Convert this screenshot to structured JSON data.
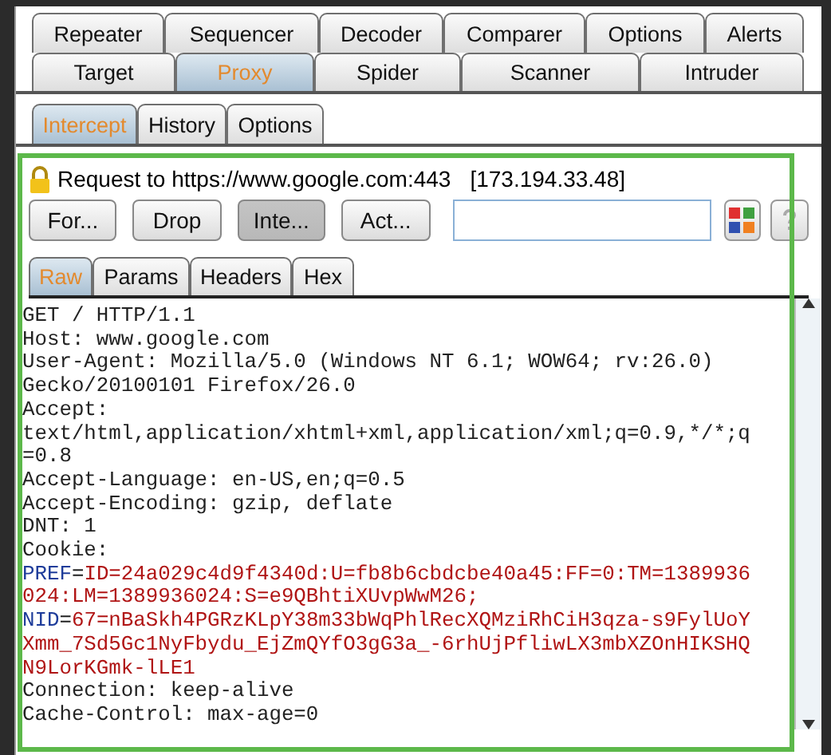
{
  "tab_rows": [
    [
      {
        "label": "Repeater",
        "selected": false
      },
      {
        "label": "Sequencer",
        "selected": false
      },
      {
        "label": "Decoder",
        "selected": false
      },
      {
        "label": "Comparer",
        "selected": false
      },
      {
        "label": "Options",
        "selected": false
      },
      {
        "label": "Alerts",
        "selected": false
      }
    ],
    [
      {
        "label": "Target",
        "selected": false
      },
      {
        "label": "Proxy",
        "selected": true
      },
      {
        "label": "Spider",
        "selected": false
      },
      {
        "label": "Scanner",
        "selected": false
      },
      {
        "label": "Intruder",
        "selected": false
      }
    ]
  ],
  "sub_tabs": [
    {
      "label": "Intercept",
      "selected": true
    },
    {
      "label": "History",
      "selected": false
    },
    {
      "label": "Options",
      "selected": false
    }
  ],
  "request": {
    "label": "Request to https://www.google.com:443",
    "address": "[173.194.33.48]"
  },
  "buttons": [
    {
      "label": "For...",
      "pressed": false
    },
    {
      "label": "Drop",
      "pressed": false
    },
    {
      "label": "Inte...",
      "pressed": true
    },
    {
      "label": "Act...",
      "pressed": false
    }
  ],
  "editor_tabs": [
    {
      "label": "Raw",
      "selected": true
    },
    {
      "label": "Params",
      "selected": false
    },
    {
      "label": "Headers",
      "selected": false
    },
    {
      "label": "Hex",
      "selected": false
    }
  ],
  "lines": [
    [
      {
        "kind": "plain",
        "text": "GET / HTTP/1.1"
      }
    ],
    [
      {
        "kind": "plain",
        "text": "Host: www.google.com"
      }
    ],
    [
      {
        "kind": "plain",
        "text": "User-Agent: Mozilla/5.0 (Windows NT 6.1; WOW64; rv:26.0)"
      }
    ],
    [
      {
        "kind": "plain",
        "text": "Gecko/20100101 Firefox/26.0"
      }
    ],
    [
      {
        "kind": "plain",
        "text": "Accept:"
      }
    ],
    [
      {
        "kind": "plain",
        "text": "text/html,application/xhtml+xml,application/xml;q=0.9,*/*;q"
      }
    ],
    [
      {
        "kind": "plain",
        "text": "=0.8"
      }
    ],
    [
      {
        "kind": "plain",
        "text": "Accept-Language: en-US,en;q=0.5"
      }
    ],
    [
      {
        "kind": "plain",
        "text": "Accept-Encoding: gzip, deflate"
      }
    ],
    [
      {
        "kind": "plain",
        "text": "DNT: 1"
      }
    ],
    [
      {
        "kind": "plain",
        "text": "Cookie:"
      }
    ],
    [
      {
        "kind": "name",
        "text": "PREF"
      },
      {
        "kind": "plain",
        "text": "="
      },
      {
        "kind": "value",
        "text": "ID=24a029c4d9f4340d:U=fb8b6cbdcbe40a45:FF=0:TM=1389936"
      }
    ],
    [
      {
        "kind": "value",
        "text": "024:LM=1389936024:S=e9QBhtiXUvpWwM26;"
      }
    ],
    [
      {
        "kind": "name",
        "text": "NID"
      },
      {
        "kind": "plain",
        "text": "="
      },
      {
        "kind": "value",
        "text": "67=nBaSkh4PGRzKLpY38m33bWqPhlRecXQMziRhCiH3qza-s9FylUoY"
      }
    ],
    [
      {
        "kind": "value",
        "text": "Xmm_7Sd5Gc1NyFbydu_EjZmQYfO3gG3a_-6rhUjPfliwLX3mbXZOnHIKSHQ"
      }
    ],
    [
      {
        "kind": "value",
        "text": "N9LorKGmk-lLE1"
      }
    ],
    [
      {
        "kind": "plain",
        "text": "Connection: keep-alive"
      }
    ],
    [
      {
        "kind": "plain",
        "text": "Cache-Control: max-age=0"
      }
    ]
  ]
}
